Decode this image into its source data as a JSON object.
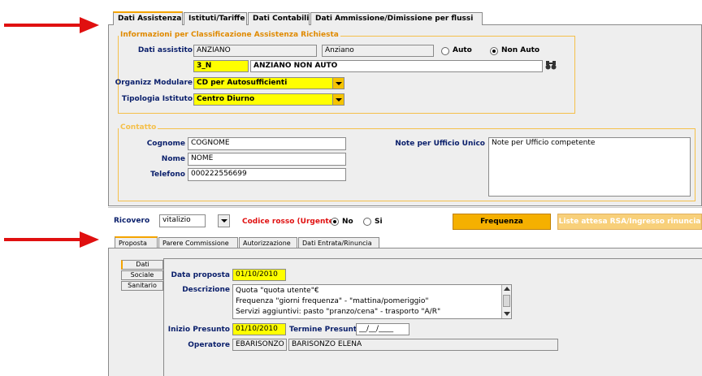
{
  "tabs": [
    "Dati Assistenza",
    "Istituti/Tariffe",
    "Dati Contabili",
    "Dati Ammissione/Dimissione per flussi"
  ],
  "classificazione": {
    "legend": "Informazioni per Classificazione Assistenza Richiesta",
    "dati_assistito_label": "Dati assistito",
    "dati_assistito_value": "ANZIANO",
    "dati_assistito_desc": "Anziano",
    "radio_auto": "Auto",
    "radio_non_auto": "Non Auto",
    "code_value": "3_N",
    "code_desc": "ANZIANO NON AUTO",
    "organizz_label": "Organizz Modulare",
    "organizz_value": "CD per Autosufficienti",
    "tipologia_label": "Tipologia Istituto",
    "tipologia_value": "Centro Diurno"
  },
  "contatto": {
    "legend": "Contatto",
    "cognome_label": "Cognome",
    "cognome_value": "COGNOME",
    "nome_label": "Nome",
    "nome_value": "NOME",
    "telefono_label": "Telefono",
    "telefono_value": "000222556699",
    "note_label": "Note per Ufficio Unico",
    "note_value": "Note per Ufficio competente"
  },
  "ricovero": {
    "label": "Ricovero",
    "value": "vitalizio",
    "codice_label": "Codice rosso (Urgente)",
    "radio_no": "No",
    "radio_si": "Si",
    "frequenza_button": "Frequenza",
    "liste_button": "Liste attesa RSA/Ingresso rinuncia"
  },
  "subtabs": [
    "Proposta",
    "Parere Commissione",
    "Autorizzazione",
    "Dati Entrata/Rinuncia"
  ],
  "vtabs": [
    "Dati",
    "Sociale",
    "Sanitario"
  ],
  "proposta": {
    "data_label": "Data proposta",
    "data_value": "01/10/2010",
    "descrizione_label": "Descrizione",
    "descrizione_lines": [
      "Quota \"quota utente\"€",
      "Frequenza \"giorni frequenza\" - \"mattina/pomeriggio\"",
      "Servizi aggiuntivi: pasto \"pranzo/cena\" -  trasporto \"A/R\""
    ],
    "inizio_label": "Inizio Presunto",
    "inizio_value": "01/10/2010",
    "termine_label": "Termine Presunto",
    "termine_value": "__/__/____",
    "operatore_label": "Operatore",
    "operatore_code": "EBARISONZO",
    "operatore_name": "BARISONZO ELENA"
  },
  "colors": {
    "accent": "#f5a400",
    "label": "#0a1f6b",
    "highlight": "#ffff00",
    "arrow": "#e01010",
    "legend": "#e08a00"
  }
}
